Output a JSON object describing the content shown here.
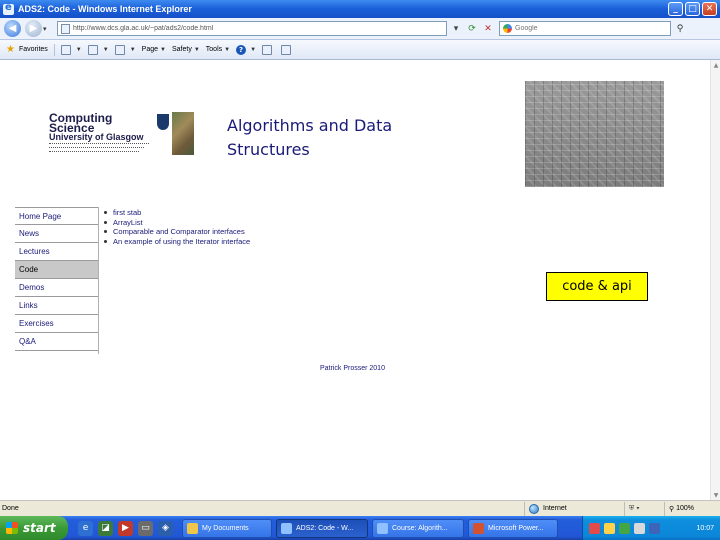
{
  "window": {
    "title": "ADS2: Code - Windows Internet Explorer",
    "minimize_label": "_",
    "maximize_label": "□",
    "close_label": "✕"
  },
  "address_bar": {
    "url": "http://www.dcs.gla.ac.uk/~pat/ads2/code.html",
    "search_placeholder": "Google"
  },
  "command_bar": {
    "favorites_label": "Favorites",
    "page_label": "Page",
    "safety_label": "Safety",
    "tools_label": "Tools"
  },
  "page": {
    "logo": {
      "line1": "Computing",
      "line2": "Science",
      "line3": "University of Glasgow"
    },
    "title_line1": "Algorithms and Data",
    "title_line2": "Structures",
    "nav": [
      {
        "label": "Home Page",
        "active": false
      },
      {
        "label": "News",
        "active": false
      },
      {
        "label": "Lectures",
        "active": false
      },
      {
        "label": "Code",
        "active": true
      },
      {
        "label": "Demos",
        "active": false
      },
      {
        "label": "Links",
        "active": false
      },
      {
        "label": "Exercises",
        "active": false
      },
      {
        "label": "Q&A",
        "active": false
      }
    ],
    "code_links": [
      "first stab",
      "ArrayList",
      "Comparable and Comparator interfaces",
      "An example of using the Iterator interface"
    ],
    "callout": "code & api",
    "credit": "Patrick Prosser 2010"
  },
  "status_bar": {
    "status": "Done",
    "zone": "Internet",
    "zoom": "100%"
  },
  "taskbar": {
    "start_label": "start",
    "tasks": [
      {
        "label": "My Documents",
        "active": false
      },
      {
        "label": "ADS2: Code - W...",
        "active": true
      },
      {
        "label": "Course: Algorith...",
        "active": false
      },
      {
        "label": "Microsoft Power...",
        "active": false
      }
    ],
    "clock": "10:07"
  },
  "colors": {
    "link_text": "#1a1a78",
    "callout_bg": "#ffff00",
    "active_nav_bg": "#c8c8c8",
    "titlebar_blue": "#1b5fd8",
    "start_green": "#3a9a36"
  }
}
